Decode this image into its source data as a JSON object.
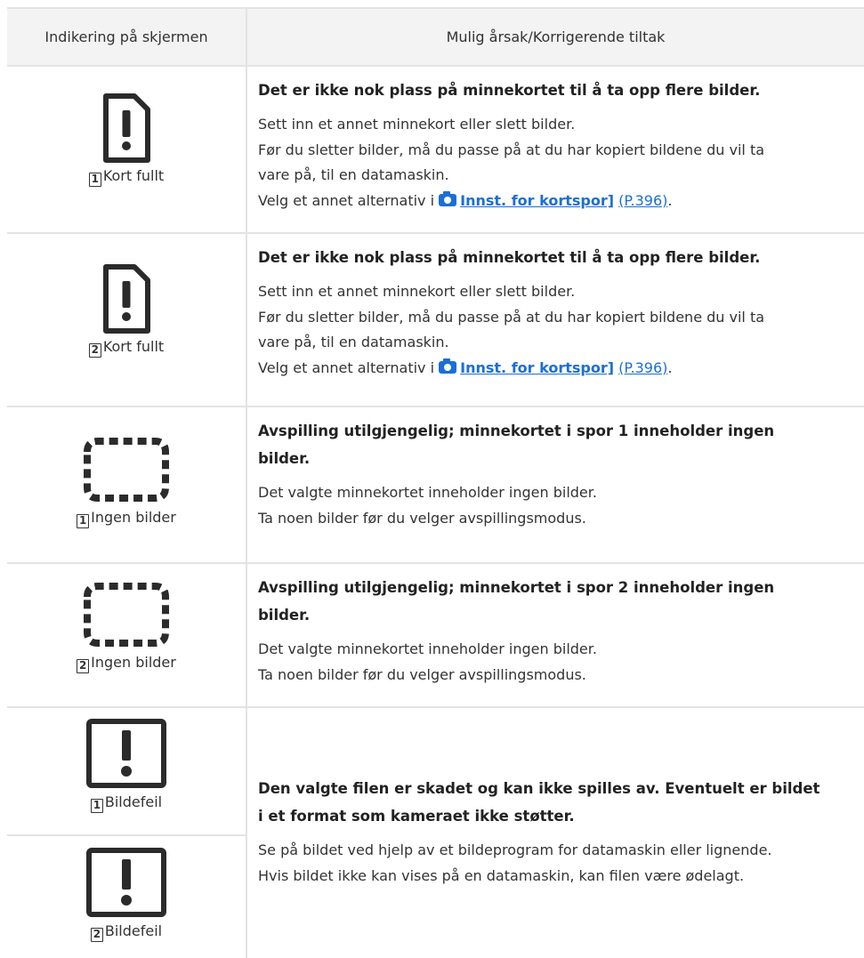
{
  "header": {
    "col_left": "Indikering på skjermen",
    "col_right": "Mulig årsak/Korrigerende tiltak"
  },
  "rows": [
    {
      "slot": "1",
      "label": "Kort fullt",
      "icon": "card-exclamation-icon",
      "title": "Det er ikke nok plass på minnekortet til å ta opp flere bilder.",
      "line1": "Sett inn et annet minnekort eller slett bilder.",
      "line2": "Før du sletter bilder, må du passe på at du har kopiert bildene du vil ta",
      "line3": "vare på, til en datamaskin.",
      "line4_prefix": "Velg et annet alternativ i ",
      "line4_link": "Innst. for kortspor]",
      "line4_ref": "(P.396)",
      "line4_end": "."
    },
    {
      "slot": "2",
      "label": "Kort fullt",
      "icon": "card-exclamation-icon",
      "title": "Det er ikke nok plass på minnekortet til å ta opp flere bilder.",
      "line1": "Sett inn et annet minnekort eller slett bilder.",
      "line2": "Før du sletter bilder, må du passe på at du har kopiert bildene du vil ta",
      "line3": "vare på, til en datamaskin.",
      "line4_prefix": "Velg et annet alternativ i ",
      "line4_link": "Innst. for kortspor]",
      "line4_ref": "(P.396)",
      "line4_end": "."
    },
    {
      "slot": "1",
      "label": "Ingen bilder",
      "icon": "dashed-frame-icon",
      "title1": "Avspilling utilgjengelig; minnekortet i spor 1 inneholder ingen",
      "title2": "bilder.",
      "line1": "Det valgte minnekortet inneholder ingen bilder.",
      "line2": "Ta noen bilder før du velger avspillingsmodus."
    },
    {
      "slot": "2",
      "label": "Ingen bilder",
      "icon": "dashed-frame-icon",
      "title1": "Avspilling utilgjengelig; minnekortet i spor 2 inneholder ingen",
      "title2": "bilder.",
      "line1": "Det valgte minnekortet inneholder ingen bilder.",
      "line2": "Ta noen bilder før du velger avspillingsmodus."
    },
    {
      "slot1": "1",
      "slot2": "2",
      "label": "Bildefeil",
      "icon": "box-exclamation-icon",
      "title1": "Den valgte filen er skadet og kan ikke spilles av. Eventuelt er bildet",
      "title2": "i et format som kameraet ikke støtter.",
      "line1": "Se på bildet ved hjelp av et bildeprogram for datamaskin eller lignende.",
      "line2": "Hvis bildet ikke kan vises på en datamaskin, kan filen være ødelagt."
    }
  ]
}
